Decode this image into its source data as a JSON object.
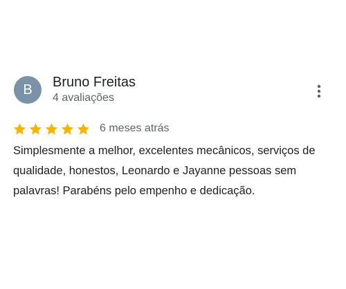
{
  "reviewer": {
    "initial": "B",
    "name": "Bruno Freitas",
    "review_count": "4 avaliações",
    "avatar_color": "#7b93a8"
  },
  "menu_icon": "more-vert-icon",
  "rating": {
    "stars": 5,
    "max_stars": 5,
    "star_color": "#f4b400",
    "date": "6 meses atrás"
  },
  "review": {
    "text": "Simplesmente a melhor, excelentes mecânicos, serviços de qualidade, honestos, Leonardo e Jayanne pessoas sem palavras! Parabéns pelo empenho e dedicação."
  }
}
